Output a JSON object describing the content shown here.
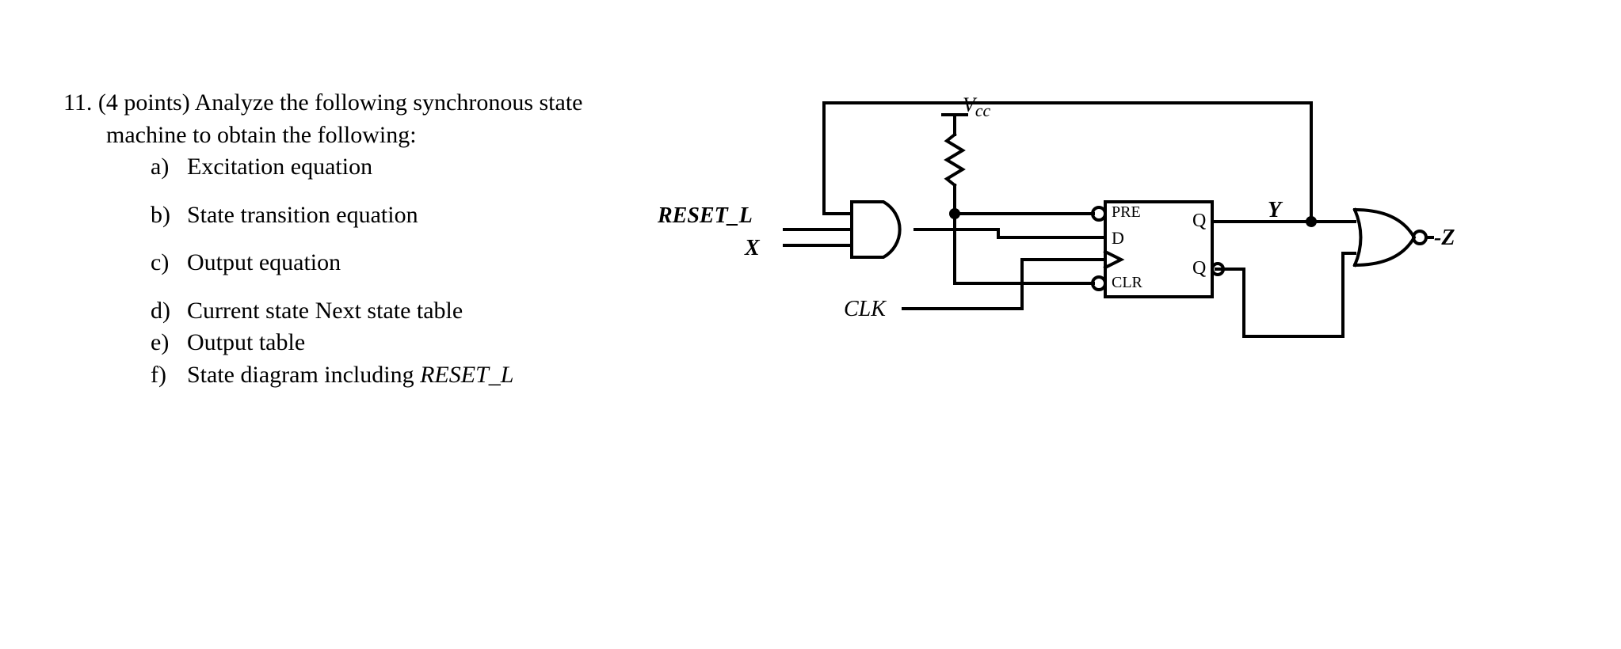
{
  "question": {
    "number": "11.",
    "points": "(4 points)",
    "prompt1": "Analyze the following synchronous state",
    "prompt2": "machine to obtain the following:",
    "subs": {
      "a": {
        "letter": "a)",
        "text": "Excitation equation"
      },
      "b": {
        "letter": "b)",
        "text": "State transition equation"
      },
      "c": {
        "letter": "c)",
        "text": "Output equation"
      },
      "d": {
        "letter": "d)",
        "text": "Current state Next state table"
      },
      "e": {
        "letter": "e)",
        "text": "Output table"
      },
      "f": {
        "letter": "f)",
        "text_prefix": "State diagram including ",
        "text_italic": "RESET_L"
      }
    }
  },
  "diagram": {
    "vcc": "V",
    "vcc_sub": "cc",
    "reset_l": "RESET_L",
    "x": "X",
    "clk": "CLK",
    "pre": "PRE",
    "d": "D",
    "clr": "CLR",
    "q": "Q",
    "qbar": "Q",
    "y": "Y",
    "z": "Z"
  }
}
